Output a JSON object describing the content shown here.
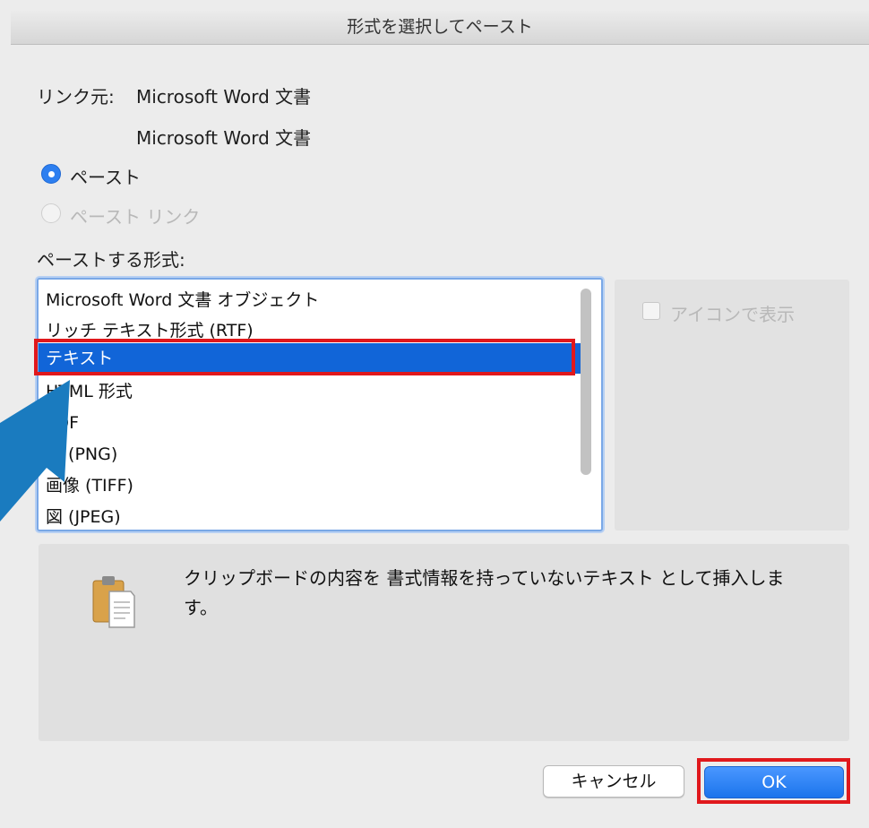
{
  "window": {
    "title": "形式を選択してペースト"
  },
  "source": {
    "label": "リンク元:",
    "value_line1": "Microsoft Word 文書",
    "value_line2": "Microsoft Word 文書"
  },
  "paste_options": [
    {
      "label": "ペースト",
      "selected": true,
      "enabled": true
    },
    {
      "label": "ペースト リンク",
      "selected": false,
      "enabled": false
    }
  ],
  "format": {
    "label": "ペーストする形式:",
    "items": [
      "Microsoft Word 文書 オブジェクト",
      "リッチ テキスト形式 (RTF)",
      "テキスト",
      "HTML 形式",
      "PDF",
      "図 (PNG)",
      "画像 (TIFF)",
      "図 (JPEG)"
    ],
    "selected_item": "テキスト"
  },
  "display_as_icon": {
    "label": "アイコンで表示",
    "checked": false,
    "enabled": false
  },
  "result": {
    "text": "クリップボードの内容を 書式情報を持っていないテキスト として挿入します。",
    "icon": "clipboard-icon"
  },
  "buttons": {
    "cancel": "キャンセル",
    "ok": "OK"
  },
  "colors": {
    "selection": "#1165d8",
    "annotation_red": "#e0181c",
    "annotation_arrow": "#1a7bbf"
  }
}
